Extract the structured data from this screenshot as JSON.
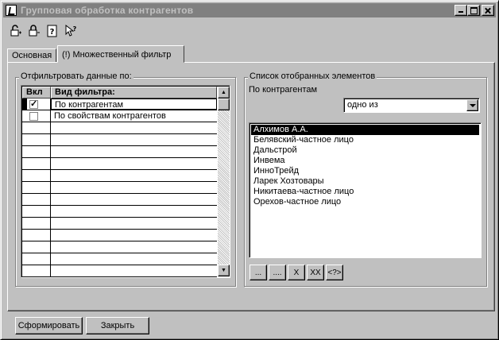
{
  "window": {
    "title": "Групповая обработка контрагентов"
  },
  "toolbar": {
    "icons": [
      "lock-open-icon",
      "lock-closed-icon",
      "help-icon",
      "context-help-icon"
    ]
  },
  "tabs": [
    {
      "label": "Основная",
      "active": false
    },
    {
      "label": "(!) Множественный фильтр",
      "active": true
    }
  ],
  "left_group": {
    "legend": "Отфильтровать данные по:",
    "columns": [
      "Вкл",
      "Вид фильтра:"
    ],
    "rows": [
      {
        "enabled": true,
        "label": "По контрагентам"
      },
      {
        "enabled": false,
        "label": "По свойствам контрагентов"
      }
    ]
  },
  "right_group": {
    "legend": "Список отобранных элементов",
    "filter_label": "По контрагентам",
    "combo_value": "одно из",
    "items": [
      "Алхимов А.А.",
      "Белявский-частное лицо",
      "Дальстрой",
      "Инвема",
      "ИнноТрейд",
      "Ларек Хозтовары",
      "Никитаева-частное лицо",
      "Орехов-частное лицо"
    ],
    "selected_index": 0,
    "buttons": [
      "...",
      "....",
      "X",
      "XX",
      "<?>"
    ]
  },
  "footer": {
    "form_label": "Сформировать",
    "close_label": "Закрыть"
  }
}
